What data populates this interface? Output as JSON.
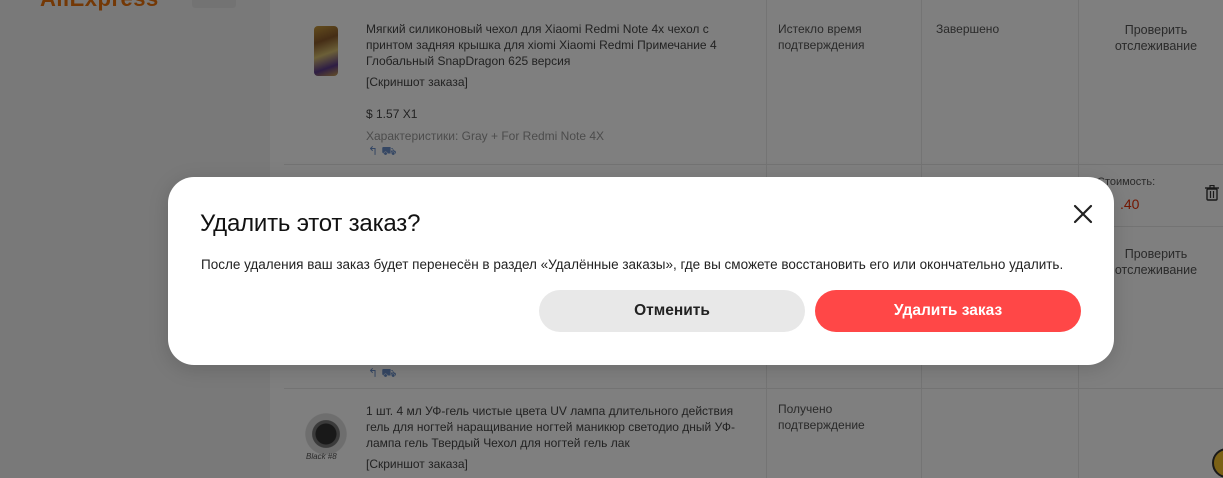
{
  "header": {
    "logo_text": "AliExpress"
  },
  "orders": [
    {
      "title": "Мягкий силиконовый чехол для Xiaomi Redmi Note 4x чехол с принтом задняя крышка для xiomi Xiaomi Redmi Примечание 4 Глобальный SnapDragon 625 версия",
      "screenshot_link": "[Скриншот заказа]",
      "price": "$ 1.57 X1",
      "specs": "Характеристики: Gray + For Redmi Note 4X",
      "status": "Истекло время подтверждения",
      "order_state": "Завершено",
      "action": "Проверить отслеживание"
    },
    {
      "cost_label": "Стоимость:",
      "cost_value": ".40",
      "action": "Проверить отслеживание"
    },
    {
      "title": "1 шт. 4 мл УФ-гель чистые цвета UV лампа длительного действия гель для ногтей наращивание ногтей маникюр светодио дный УФ-лампа гель Твердый Чехол для ногтей гель лак",
      "screenshot_link": "[Скриншот заказа]",
      "thumb_caption": "Black #8",
      "status": "Получено подтверждение"
    }
  ],
  "modal": {
    "title": "Удалить этот заказ?",
    "body": "После удаления ваш заказ будет перенесён в раздел «Удалённые заказы», где вы сможете восстановить его или окончательно удалить.",
    "cancel_label": "Отменить",
    "delete_label": "Удалить заказ"
  },
  "colors": {
    "accent": "#ff4747",
    "brand": "#e8710a",
    "price_red": "#e62e04"
  },
  "icons": [
    "close-icon",
    "trash-icon",
    "return-icon",
    "delivery-truck-icon",
    "helper-bubble-icon"
  ]
}
